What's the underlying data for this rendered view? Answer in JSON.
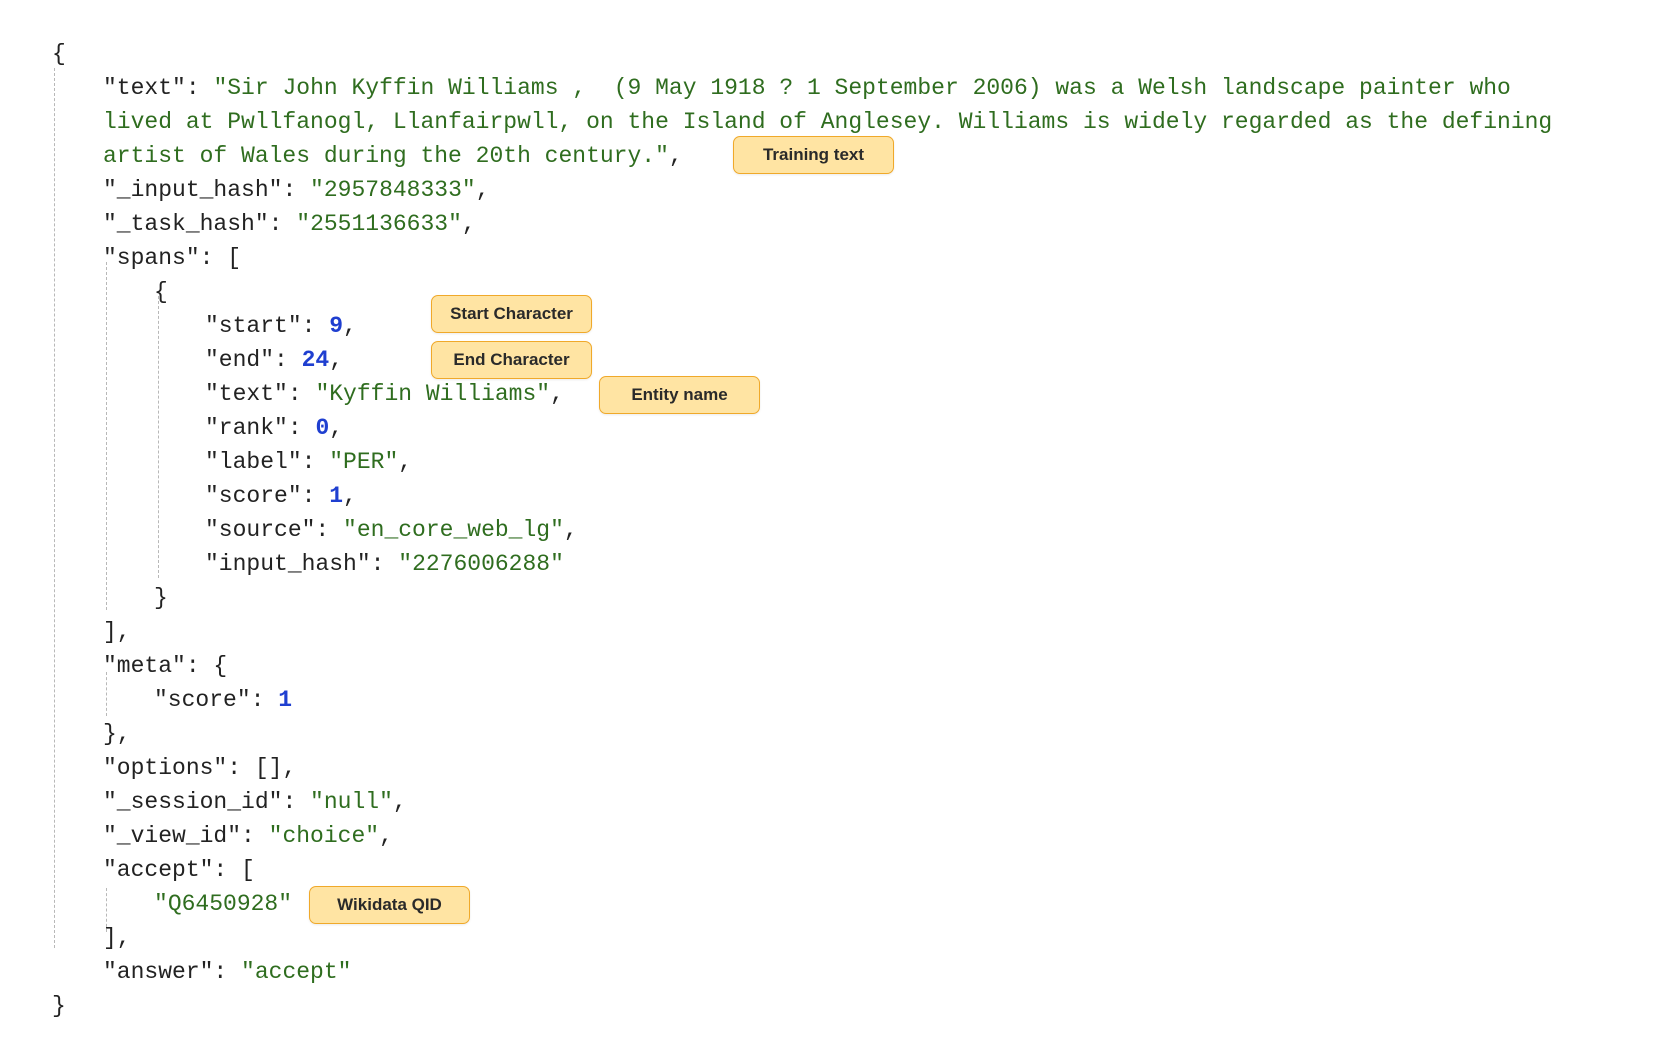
{
  "json_doc": {
    "text_line1": "Sir John Kyffin Williams ,  (9 May 1918 ? 1 September 2006) was a Welsh landscape painter who",
    "text_line2": "lived at Pwllfanogl, Llanfairpwll, on the Island of Anglesey. Williams is widely regarded as the defining",
    "text_line3": "artist of Wales during the 20th century.",
    "input_hash": "2957848333",
    "task_hash": "2551136633",
    "spans": [
      {
        "start": "9",
        "end": "24",
        "text": "Kyffin Williams",
        "rank": "0",
        "label": "PER",
        "score": "1",
        "source": "en_core_web_lg",
        "input_hash": "2276006288"
      }
    ],
    "meta_score": "1",
    "options": "[]",
    "session_id": "null",
    "view_id": "choice",
    "accept": [
      "Q6450928"
    ],
    "answer": "accept"
  },
  "keys": {
    "text": "\"text\"",
    "input_hash": "\"_input_hash\"",
    "task_hash": "\"_task_hash\"",
    "spans": "\"spans\"",
    "start": "\"start\"",
    "end": "\"end\"",
    "span_text": "\"text\"",
    "rank": "\"rank\"",
    "label": "\"label\"",
    "score": "\"score\"",
    "source": "\"source\"",
    "span_input_hash": "\"input_hash\"",
    "meta": "\"meta\"",
    "meta_score": "\"score\"",
    "options": "\"options\"",
    "session_id": "\"_session_id\"",
    "view_id": "\"_view_id\"",
    "accept": "\"accept\"",
    "answer": "\"answer\""
  },
  "annotations": {
    "training_text": "Training text",
    "start_character": "Start Character",
    "end_character": "End Character",
    "entity_name": "Entity name",
    "wikidata_qid": "Wikidata QID"
  },
  "colors": {
    "key": "#222222",
    "string": "#2f6d1f",
    "number": "#1f3fd0",
    "tag_fill": "#ffe4a3",
    "tag_border": "#f0a92a"
  }
}
